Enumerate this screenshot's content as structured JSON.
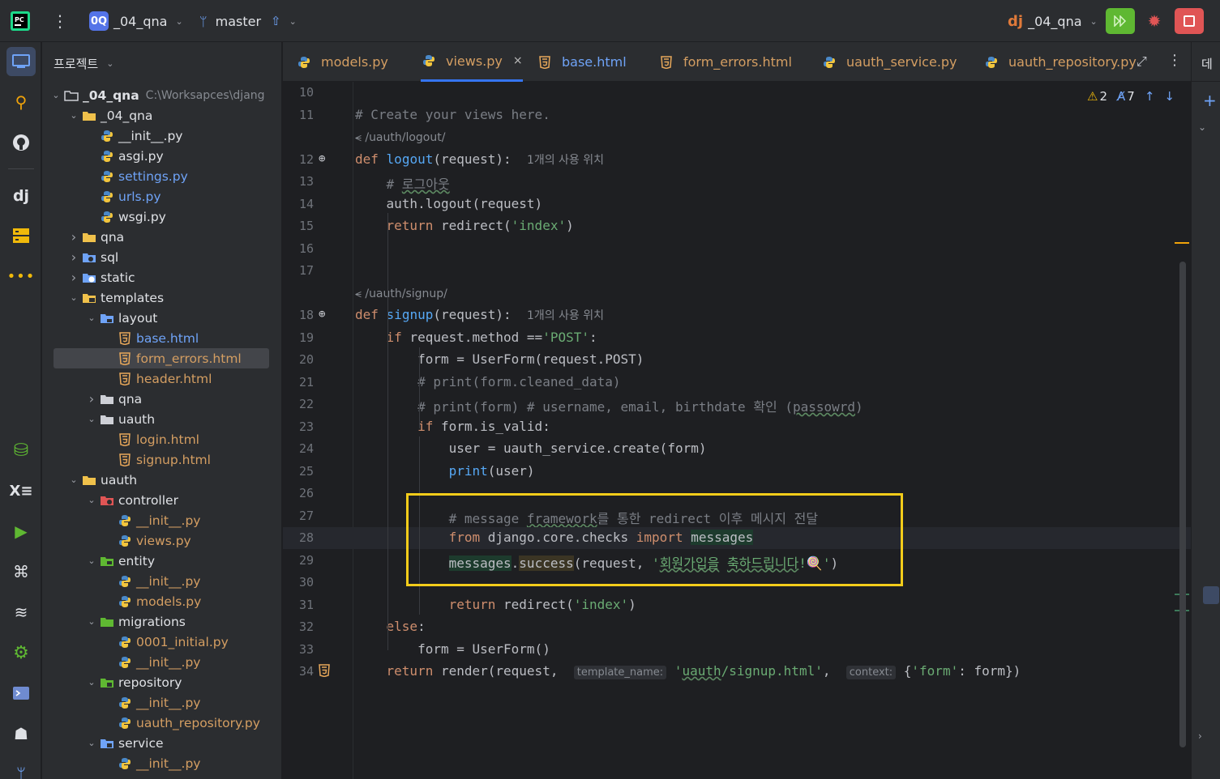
{
  "topbar": {
    "project_badge": "0Q",
    "project_name": "_04_qna",
    "branch": "master",
    "run_config": "_04_qna"
  },
  "project_panel": {
    "title": "프로젝트",
    "tree": [
      {
        "label": "_04_qna",
        "path": "C:\\Worksapces\\djang",
        "depth": 0,
        "type": "folder-root",
        "open": true
      },
      {
        "label": "_04_qna",
        "depth": 1,
        "type": "folder",
        "open": true
      },
      {
        "label": "__init__.py",
        "depth": 2,
        "type": "py"
      },
      {
        "label": "asgi.py",
        "depth": 2,
        "type": "py"
      },
      {
        "label": "settings.py",
        "depth": 2,
        "type": "py",
        "color": "blue"
      },
      {
        "label": "urls.py",
        "depth": 2,
        "type": "py",
        "color": "blue"
      },
      {
        "label": "wsgi.py",
        "depth": 2,
        "type": "py"
      },
      {
        "label": "qna",
        "depth": 1,
        "type": "folder",
        "open": false
      },
      {
        "label": "sql",
        "depth": 1,
        "type": "folder-sql",
        "open": false
      },
      {
        "label": "static",
        "depth": 1,
        "type": "folder-web",
        "open": false
      },
      {
        "label": "templates",
        "depth": 1,
        "type": "folder-tpl",
        "open": true
      },
      {
        "label": "layout",
        "depth": 2,
        "type": "folder-blue",
        "open": true
      },
      {
        "label": "base.html",
        "depth": 3,
        "type": "html",
        "color": "blue"
      },
      {
        "label": "form_errors.html",
        "depth": 3,
        "type": "html",
        "color": "orange",
        "selected": true
      },
      {
        "label": "header.html",
        "depth": 3,
        "type": "html",
        "color": "orange"
      },
      {
        "label": "qna",
        "depth": 2,
        "type": "folder-gray",
        "open": false
      },
      {
        "label": "uauth",
        "depth": 2,
        "type": "folder-gray",
        "open": true
      },
      {
        "label": "login.html",
        "depth": 3,
        "type": "html",
        "color": "orange"
      },
      {
        "label": "signup.html",
        "depth": 3,
        "type": "html",
        "color": "orange"
      },
      {
        "label": "uauth",
        "depth": 1,
        "type": "folder",
        "open": true
      },
      {
        "label": "controller",
        "depth": 2,
        "type": "folder-ctrl",
        "open": true
      },
      {
        "label": "__init__.py",
        "depth": 3,
        "type": "py",
        "color": "orange"
      },
      {
        "label": "views.py",
        "depth": 3,
        "type": "py",
        "color": "orange"
      },
      {
        "label": "entity",
        "depth": 2,
        "type": "folder-entity",
        "open": true
      },
      {
        "label": "__init__.py",
        "depth": 3,
        "type": "py",
        "color": "orange"
      },
      {
        "label": "models.py",
        "depth": 3,
        "type": "py",
        "color": "orange"
      },
      {
        "label": "migrations",
        "depth": 2,
        "type": "folder-mig",
        "open": true
      },
      {
        "label": "0001_initial.py",
        "depth": 3,
        "type": "py",
        "color": "orange"
      },
      {
        "label": "__init__.py",
        "depth": 3,
        "type": "py",
        "color": "orange"
      },
      {
        "label": "repository",
        "depth": 2,
        "type": "folder-repo",
        "open": true
      },
      {
        "label": "__init__.py",
        "depth": 3,
        "type": "py",
        "color": "orange"
      },
      {
        "label": "uauth_repository.py",
        "depth": 3,
        "type": "py",
        "color": "orange"
      },
      {
        "label": "service",
        "depth": 2,
        "type": "folder-svc",
        "open": true
      },
      {
        "label": "__init__.py",
        "depth": 3,
        "type": "py",
        "color": "orange"
      }
    ]
  },
  "tabs": [
    {
      "label": "models.py",
      "type": "py",
      "color": "orange"
    },
    {
      "label": "views.py",
      "type": "py",
      "color": "orange",
      "active": true,
      "close": "×"
    },
    {
      "label": "base.html",
      "type": "html",
      "color": "blue"
    },
    {
      "label": "form_errors.html",
      "type": "html",
      "color": "orange"
    },
    {
      "label": "uauth_service.py",
      "type": "py",
      "color": "orange"
    },
    {
      "label": "uauth_repository.py",
      "type": "py",
      "color": "orange"
    }
  ],
  "right_strip_label": "데",
  "problems": {
    "warnings": "2",
    "typos": "7"
  },
  "editor": {
    "current_line": 28,
    "lines": [
      {
        "n": "10",
        "html": ""
      },
      {
        "n": "11",
        "html": "<span class='cm'># Create your views here.</span>"
      },
      {
        "n": "",
        "html": "<span class='urlline'>&lt;&#x2F;uauth/logout/</span>",
        "url": "/uauth/logout/"
      },
      {
        "n": "12",
        "gut": "⊕",
        "html": "<span class='kw'>def</span> <span class='def'>logout</span>(request):  <span class='hint'>1개의 사용 위치</span>"
      },
      {
        "n": "13",
        "html": "    <span class='cm'># <span class='wavy'>로그아웃</span></span>"
      },
      {
        "n": "14",
        "html": "    auth.logout(request)"
      },
      {
        "n": "15",
        "html": "    <span class='kw'>return</span> redirect(<span class='str'>'index'</span>)"
      },
      {
        "n": "16",
        "html": ""
      },
      {
        "n": "17",
        "html": ""
      },
      {
        "n": "",
        "html": "<span class='urlline'>/uauth/signup/</span>"
      },
      {
        "n": "18",
        "gut": "⊕",
        "html": "<span class='kw'>def</span> <span class='def'>signup</span>(request):  <span class='hint'>1개의 사용 위치</span>"
      },
      {
        "n": "19",
        "html": "    <span class='kw'>if</span> request.method ==<span class='str'>'POST'</span>:"
      },
      {
        "n": "20",
        "html": "        form = UserForm(request.POST)"
      },
      {
        "n": "21",
        "html": "        <span class='cm'># print(form.cleaned_data)</span>"
      },
      {
        "n": "22",
        "html": "        <span class='cm'># print(form) # username, email, birthdate 확인 (<span class='wavy'>passowrd</span>)</span>"
      },
      {
        "n": "23",
        "html": "        <span class='kw'>if</span> form.is_valid:"
      },
      {
        "n": "24",
        "html": "            user = uauth_service.create(form)"
      },
      {
        "n": "25",
        "html": "            <span class='fn'>print</span>(user)"
      },
      {
        "n": "26",
        "html": ""
      },
      {
        "n": "27",
        "html": "            <span class='cm'># message <span class='wavy'>framework</span>를 통한 redirect 이후 메시지 전달</span>"
      },
      {
        "n": "28",
        "html": "            <span class='kw'>from</span> django.core.checks <span class='kw'>import</span> <span class='hl1'>messages</span>"
      },
      {
        "n": "29",
        "html": "            <span class='hl1'>messages</span>.<span class='hl2'>success</span>(request, <span class='str'>'<span class='wavy'>회원가입을</span> <span class='wavy'>축하드립니다</span>!🍭'</span>)"
      },
      {
        "n": "30",
        "html": ""
      },
      {
        "n": "31",
        "html": "            <span class='kw'>return</span> redirect(<span class='str'>'index'</span>)"
      },
      {
        "n": "32",
        "html": "    <span class='kw'>else</span>:"
      },
      {
        "n": "33",
        "html": "        form = UserForm()"
      },
      {
        "n": "34",
        "gut": "5",
        "html": "    <span class='kw'>return</span> render(request,  <span class='inlay'>template_name:</span> <span class='str'>'<span class='wavy'>uauth</span>/signup.html'</span>,  <span class='inlay'>context:</span> {<span class='str'>'form'</span>: form})"
      }
    ]
  },
  "colors": {
    "accent": "#3574f0",
    "highlight_box": "#f3cc1a",
    "run_green": "#5fb832",
    "stop_red": "#e05555"
  }
}
